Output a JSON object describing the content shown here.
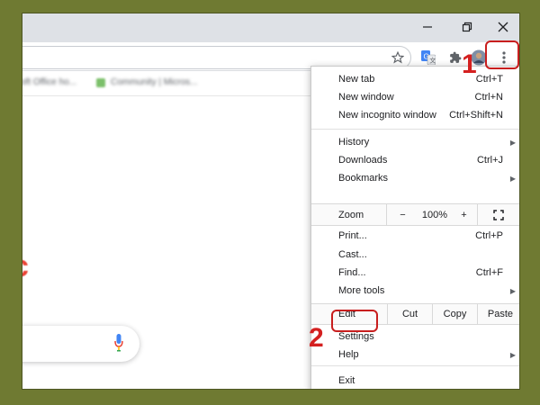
{
  "toolbar": {
    "bookmarks": [
      "oft Office ho...",
      "Community | Micros..."
    ]
  },
  "menu": {
    "new_tab": {
      "label": "New tab",
      "shortcut": "Ctrl+T"
    },
    "new_window": {
      "label": "New window",
      "shortcut": "Ctrl+N"
    },
    "new_incognito": {
      "label": "New incognito window",
      "shortcut": "Ctrl+Shift+N"
    },
    "history": {
      "label": "History"
    },
    "downloads": {
      "label": "Downloads",
      "shortcut": "Ctrl+J"
    },
    "bookmarks": {
      "label": "Bookmarks"
    },
    "zoom": {
      "label": "Zoom",
      "minus": "−",
      "value": "100%",
      "plus": "+"
    },
    "print": {
      "label": "Print...",
      "shortcut": "Ctrl+P"
    },
    "cast": {
      "label": "Cast..."
    },
    "find": {
      "label": "Find...",
      "shortcut": "Ctrl+F"
    },
    "more_tools": {
      "label": "More tools"
    },
    "edit": {
      "label": "Edit",
      "cut": "Cut",
      "copy": "Copy",
      "paste": "Paste"
    },
    "settings": {
      "label": "Settings"
    },
    "help": {
      "label": "Help"
    },
    "exit": {
      "label": "Exit"
    }
  },
  "annotations": {
    "step1": "1",
    "step2": "2"
  },
  "colors": {
    "highlight": "#c81e1e",
    "background": "#6f7a32"
  },
  "icons": [
    "minimize-icon",
    "maximize-icon",
    "close-icon",
    "star-icon",
    "translate-icon",
    "extensions-icon",
    "avatar",
    "more-icon",
    "mic-icon",
    "fullscreen-icon"
  ]
}
